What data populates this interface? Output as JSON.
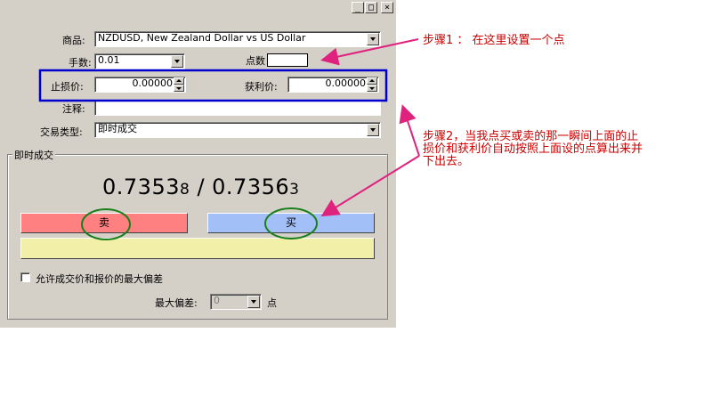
{
  "window": {
    "min_label": "_",
    "max_label": "□",
    "close_label": "×"
  },
  "form": {
    "symbol_label": "商品:",
    "symbol_value": "NZDUSD, New Zealand Dollar vs US Dollar",
    "volume_label": "手数:",
    "volume_value": "0.01",
    "points_label": "点数",
    "points_value": "",
    "stoploss_label": "止损价:",
    "stoploss_value": "0.00000",
    "takeprofit_label": "获利价:",
    "takeprofit_value": "0.00000",
    "comment_label": "注释:",
    "comment_value": "",
    "type_label": "交易类型:",
    "type_value": "即时成交"
  },
  "instant": {
    "group_title": "即时成交",
    "bid_main": "0.7353",
    "bid_small": "8",
    "separator": " / ",
    "ask_main": "0.7356",
    "ask_small": "3",
    "sell_label": "卖",
    "buy_label": "买",
    "deviation_checkbox_label": "允许成交价和报价的最大偏差",
    "max_dev_label": "最大偏差:",
    "max_dev_value": "0",
    "max_dev_unit": "点"
  },
  "annotations": {
    "step1": "步骤1 ： 在这里设置一个点",
    "step2_line1": "步骤2，当我点买或卖的那一瞬间上面的止",
    "step2_line2": "损价和获利价自动按照上面设的点算出来并",
    "step2_line3": "下出去。"
  },
  "colors": {
    "dialog_bg": "#d4d0c8",
    "sell": "#ff8080",
    "buy": "#a3bff7",
    "close_button": "#f2efa8",
    "annotation_text": "#cc0000",
    "arrow": "#e0227f",
    "highlight_box": "#0000cc",
    "circle": "#1a7f1a"
  }
}
